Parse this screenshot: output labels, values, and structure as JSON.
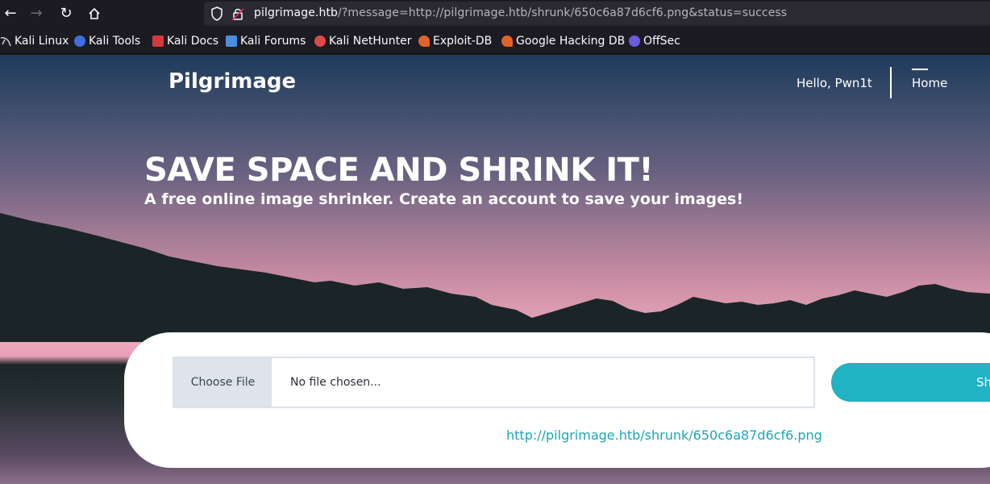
{
  "browser": {
    "url_host": "pilgrimage.htb",
    "url_rest": "/?message=http://pilgrimage.htb/shrunk/650c6a87d6cf6.png&status=success",
    "bookmarks": [
      {
        "label": "Kali Linux",
        "icon": "kali-dragon-icon",
        "color": "#cccccc"
      },
      {
        "label": "Kali Tools",
        "icon": "kali-tools-icon",
        "color": "#3d6ee0"
      },
      {
        "label": "Kali Docs",
        "icon": "kali-docs-icon",
        "color": "#d23b3b"
      },
      {
        "label": "Kali Forums",
        "icon": "kali-forums-icon",
        "color": "#4c8de0"
      },
      {
        "label": "Kali NetHunter",
        "icon": "nethunter-icon",
        "color": "#e04848"
      },
      {
        "label": "Exploit-DB",
        "icon": "exploit-db-icon",
        "color": "#e0622d"
      },
      {
        "label": "Google Hacking DB",
        "icon": "ghdb-icon",
        "color": "#e0622d"
      },
      {
        "label": "OffSec",
        "icon": "offsec-icon",
        "color": "#6a5ae0"
      }
    ]
  },
  "site": {
    "brand": "Pilgrimage",
    "greeting": "Hello, Pwn1t",
    "nav_home": "Home",
    "hero_title": "SAVE SPACE AND SHRINK IT!",
    "hero_subtitle": "A free online image shrinker. Create an account to save your images!",
    "choose_file": "Choose File",
    "no_file": "No file chosen...",
    "submit_label": "Sh",
    "result_url": "http://pilgrimage.htb/shrunk/650c6a87d6cf6.png"
  },
  "colors": {
    "accent": "#1fb3c4",
    "link": "#1aa6b7"
  }
}
